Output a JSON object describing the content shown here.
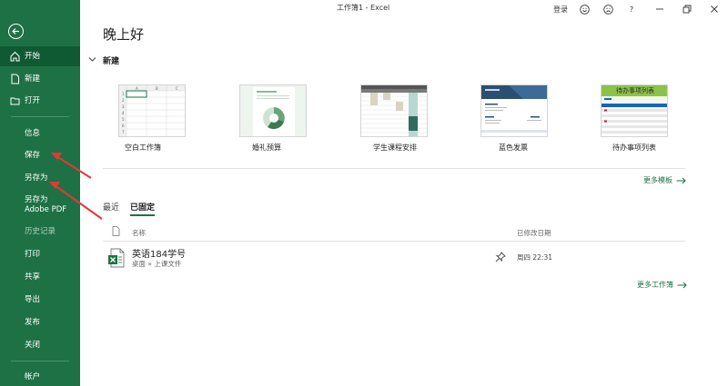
{
  "window": {
    "title": "工作簿1 - Excel"
  },
  "titlebar": {
    "login": "登录",
    "smile_icon": "smile-icon",
    "frown_icon": "frown-icon",
    "help": "?",
    "minimize": "minimize-icon",
    "restore": "restore-icon",
    "close": "close-icon"
  },
  "sidebar": {
    "back_icon": "back-arrow-icon",
    "items": [
      {
        "label": "开始",
        "icon": "home-icon"
      },
      {
        "label": "新建",
        "icon": "new-file-icon"
      },
      {
        "label": "打开",
        "icon": "open-folder-icon"
      },
      {
        "label": "信息"
      },
      {
        "label": "保存"
      },
      {
        "label": "另存为"
      },
      {
        "label": "另存为 Adobe PDF"
      },
      {
        "label": "历史记录"
      },
      {
        "label": "打印"
      },
      {
        "label": "共享"
      },
      {
        "label": "导出"
      },
      {
        "label": "发布"
      },
      {
        "label": "关闭"
      },
      {
        "label": "帐户"
      }
    ]
  },
  "main": {
    "greeting": "晚上好",
    "new_section": "新建",
    "templates": [
      {
        "label": "空白工作簿"
      },
      {
        "label": "婚礼预算"
      },
      {
        "label": "学生课程安排"
      },
      {
        "label": "蓝色发票"
      },
      {
        "label": "待办事项列表",
        "thumb_title": "待办事项列表"
      }
    ],
    "more_templates": "更多模板",
    "tabs": [
      {
        "label": "最近"
      },
      {
        "label": "已固定"
      }
    ],
    "columns": {
      "name": "名称",
      "modified": "已修改日期"
    },
    "files": [
      {
        "name": "英语184学号",
        "path": "桌面 » 上课文件",
        "date": "周四 22:31"
      }
    ],
    "more_workbooks": "更多工作簿"
  },
  "colors": {
    "accent": "#1e7145",
    "annotation": "#e53935"
  }
}
